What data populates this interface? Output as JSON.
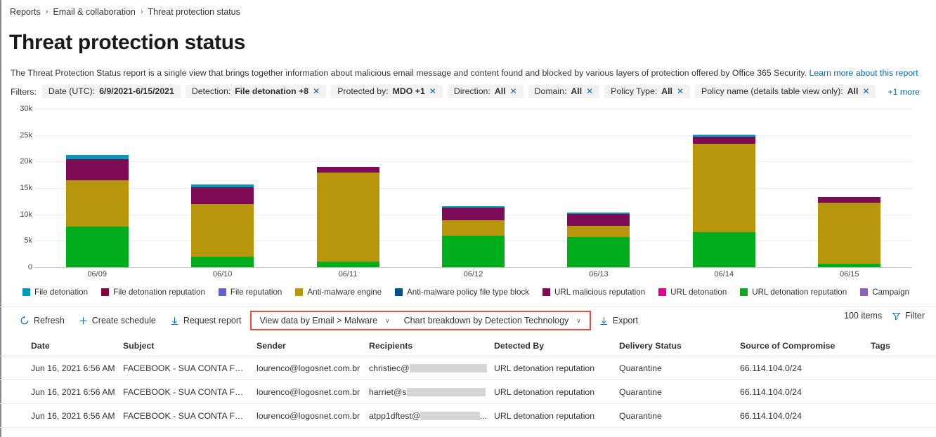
{
  "breadcrumb": {
    "items": [
      "Reports",
      "Email & collaboration",
      "Threat protection status"
    ],
    "separator": "›"
  },
  "page_title": "Threat protection status",
  "description": {
    "text": "The Threat Protection Status report is a single view that brings together information about malicious email message and content found and blocked by various layers of protection offered by Office 365 Security.",
    "link": "Learn more about this report"
  },
  "filters": {
    "label": "Filters:",
    "pills": [
      {
        "label": "Date (UTC):",
        "value": "6/9/2021-6/15/2021",
        "closable": false
      },
      {
        "label": "Detection:",
        "value": "File detonation +8",
        "closable": true
      },
      {
        "label": "Protected by:",
        "value": "MDO +1",
        "closable": true
      },
      {
        "label": "Direction:",
        "value": "All",
        "closable": true
      },
      {
        "label": "Domain:",
        "value": "All",
        "closable": true
      },
      {
        "label": "Policy Type:",
        "value": "All",
        "closable": true
      },
      {
        "label": "Policy name (details table view only):",
        "value": "All",
        "closable": true
      }
    ],
    "more": "+1 more",
    "close_glyph": "✕"
  },
  "chart_data": {
    "type": "bar",
    "stacked": true,
    "title": "",
    "xlabel": "",
    "ylabel": "",
    "ylim": [
      0,
      30000
    ],
    "yticks": [
      0,
      5000,
      10000,
      15000,
      20000,
      25000,
      30000
    ],
    "ytick_labels": [
      "0",
      "5k",
      "10k",
      "15k",
      "20k",
      "25k",
      "30k"
    ],
    "grid": true,
    "legend_position": "bottom",
    "categories": [
      "06/09",
      "06/10",
      "06/11",
      "06/12",
      "06/13",
      "06/14",
      "06/15"
    ],
    "series": [
      {
        "name": "URL detonation reputation",
        "color": "#00ad1d",
        "values": [
          7700,
          2000,
          1000,
          6000,
          5700,
          6700,
          600
        ]
      },
      {
        "name": "Anti-malware engine",
        "color": "#b8960c",
        "values": [
          8700,
          9900,
          16900,
          2900,
          2100,
          16600,
          11600
        ]
      },
      {
        "name": "URL malicious reputation",
        "color": "#7d0a55",
        "values": [
          4100,
          3300,
          1100,
          2400,
          2300,
          1400,
          1100
        ]
      },
      {
        "name": "File detonation",
        "color": "#0099bc",
        "values": [
          800,
          500,
          0,
          250,
          250,
          350,
          0
        ]
      },
      {
        "name": "File detonation reputation",
        "color": "#86003c",
        "values": [
          0,
          0,
          0,
          0,
          0,
          0,
          0
        ]
      },
      {
        "name": "File reputation",
        "color": "#5f5fd9",
        "values": [
          0,
          0,
          0,
          0,
          0,
          0,
          0
        ]
      },
      {
        "name": "Anti-malware policy file type block",
        "color": "#004e8c",
        "values": [
          0,
          0,
          0,
          0,
          0,
          0,
          0
        ]
      },
      {
        "name": "URL detonation",
        "color": "#e3008c",
        "values": [
          0,
          0,
          0,
          0,
          0,
          0,
          0
        ]
      },
      {
        "name": "Campaign",
        "color": "#8764b8",
        "values": [
          0,
          0,
          0,
          0,
          0,
          0,
          0
        ]
      }
    ],
    "legend": [
      {
        "label": "File detonation",
        "color": "#0099bc"
      },
      {
        "label": "File detonation reputation",
        "color": "#86003c"
      },
      {
        "label": "File reputation",
        "color": "#5f5fd9"
      },
      {
        "label": "Anti-malware engine",
        "color": "#b8960c"
      },
      {
        "label": "Anti-malware policy file type block",
        "color": "#004e8c"
      },
      {
        "label": "URL malicious reputation",
        "color": "#7d0a55"
      },
      {
        "label": "URL detonation",
        "color": "#e3008c"
      },
      {
        "label": "URL detonation reputation",
        "color": "#00ad1d"
      },
      {
        "label": "Campaign",
        "color": "#8764b8"
      }
    ]
  },
  "toolbar": {
    "refresh": "Refresh",
    "create_schedule": "Create schedule",
    "request_report": "Request report",
    "view_data_by": "View data by Email > Malware",
    "chart_breakdown": "Chart breakdown by Detection Technology",
    "export": "Export",
    "items_count": "100 items",
    "filter": "Filter",
    "chevron": "∨"
  },
  "table": {
    "columns": [
      "Date",
      "Subject",
      "Sender",
      "Recipients",
      "Detected By",
      "Delivery Status",
      "Source of Compromise",
      "Tags"
    ],
    "rows": [
      {
        "date": "Jun 16, 2021 6:56 AM",
        "subject": "FACEBOOK - SUA CONTA FOI TEMP...",
        "sender": "lourenco@logosnet.com.br",
        "recipient_prefix": "christiec@",
        "recipient_suffix": "",
        "detected_by": "URL detonation reputation",
        "delivery_status": "Quarantine",
        "source_of_compromise": "66.114.104.0/24",
        "tags": ""
      },
      {
        "date": "Jun 16, 2021 6:56 AM",
        "subject": "FACEBOOK - SUA CONTA FOI TEMP...",
        "sender": "lourenco@logosnet.com.br",
        "recipient_prefix": "harriet@s",
        "recipient_suffix": "",
        "detected_by": "URL detonation reputation",
        "delivery_status": "Quarantine",
        "source_of_compromise": "66.114.104.0/24",
        "tags": ""
      },
      {
        "date": "Jun 16, 2021 6:56 AM",
        "subject": "FACEBOOK - SUA CONTA FOI TEMP...",
        "sender": "lourenco@logosnet.com.br",
        "recipient_prefix": "atpp1dftest@",
        "recipient_suffix": "...",
        "detected_by": "URL detonation reputation",
        "delivery_status": "Quarantine",
        "source_of_compromise": "66.114.104.0/24",
        "tags": ""
      }
    ]
  }
}
